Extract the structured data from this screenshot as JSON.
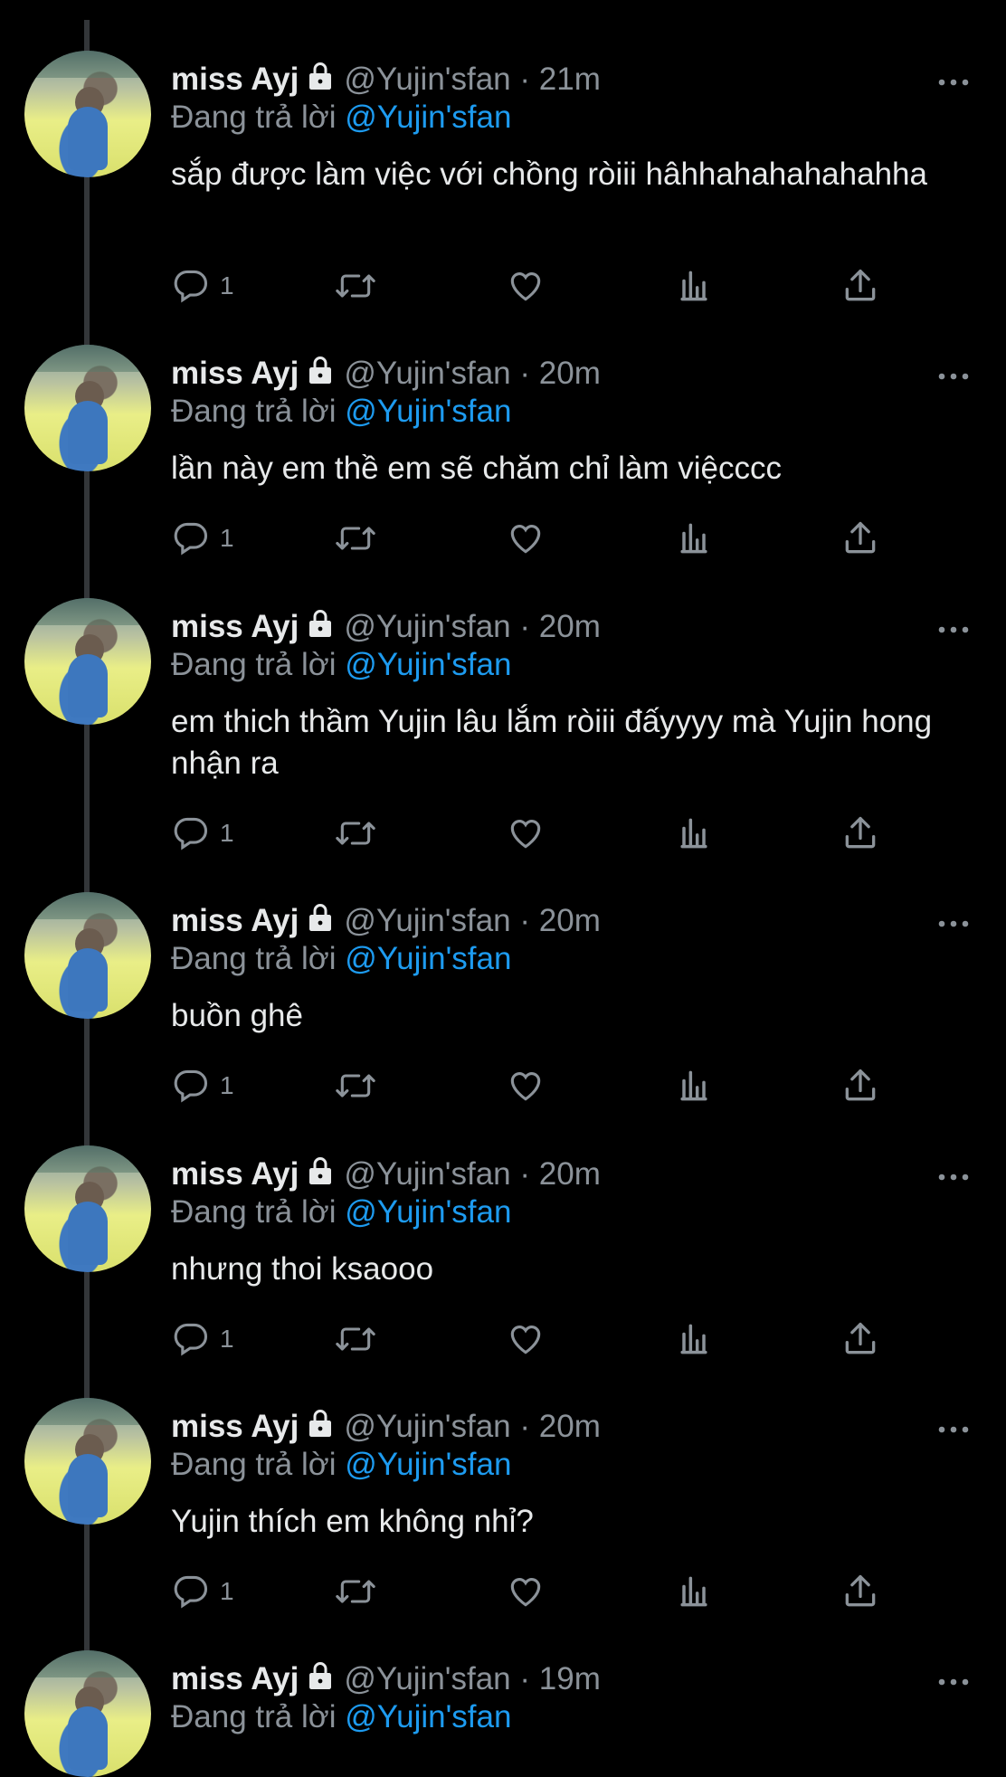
{
  "tweets": [
    {
      "name": "miss Ayj",
      "handle": "@Yujin'sfan",
      "time": "21m",
      "reply_prefix": "Đang trả lời",
      "reply_to": "@Yujin'sfan",
      "text": "sắp được làm việc với chồng ròiii hâhhahahahahahha",
      "reply_count": "1"
    },
    {
      "name": "miss Ayj",
      "handle": "@Yujin'sfan",
      "time": "20m",
      "reply_prefix": "Đang trả lời",
      "reply_to": "@Yujin'sfan",
      "text": "lần này em thề em sẽ chăm chỉ làm việcccc",
      "reply_count": "1"
    },
    {
      "name": "miss Ayj",
      "handle": "@Yujin'sfan",
      "time": "20m",
      "reply_prefix": "Đang trả lời",
      "reply_to": "@Yujin'sfan",
      "text": "em thich thầm Yujin lâu lắm ròiii đấyyyy mà Yujin hong nhận ra",
      "reply_count": "1"
    },
    {
      "name": "miss Ayj",
      "handle": "@Yujin'sfan",
      "time": "20m",
      "reply_prefix": "Đang trả lời",
      "reply_to": "@Yujin'sfan",
      "text": "buồn ghê",
      "reply_count": "1"
    },
    {
      "name": "miss Ayj",
      "handle": "@Yujin'sfan",
      "time": "20m",
      "reply_prefix": "Đang trả lời",
      "reply_to": "@Yujin'sfan",
      "text": "nhưng thoi ksaooo",
      "reply_count": "1"
    },
    {
      "name": "miss Ayj",
      "handle": "@Yujin'sfan",
      "time": "20m",
      "reply_prefix": "Đang trả lời",
      "reply_to": "@Yujin'sfan",
      "text": "Yujin thích em không nhỉ?",
      "reply_count": "1"
    },
    {
      "name": "miss Ayj",
      "handle": "@Yujin'sfan",
      "time": "19m",
      "reply_prefix": "Đang trả lời",
      "reply_to": "@Yujin'sfan",
      "text": "",
      "reply_count": ""
    }
  ],
  "separator": "·",
  "icons": {
    "more": "more-horizontal-icon",
    "lock": "lock-icon",
    "reply": "reply-bubble-icon",
    "retweet": "retweet-icon",
    "like": "heart-icon",
    "views": "analytics-icon",
    "share": "share-upload-icon"
  },
  "colors": {
    "background": "#000000",
    "text": "#e7e9ea",
    "muted": "#8b9299",
    "link": "#1d9bf0"
  }
}
